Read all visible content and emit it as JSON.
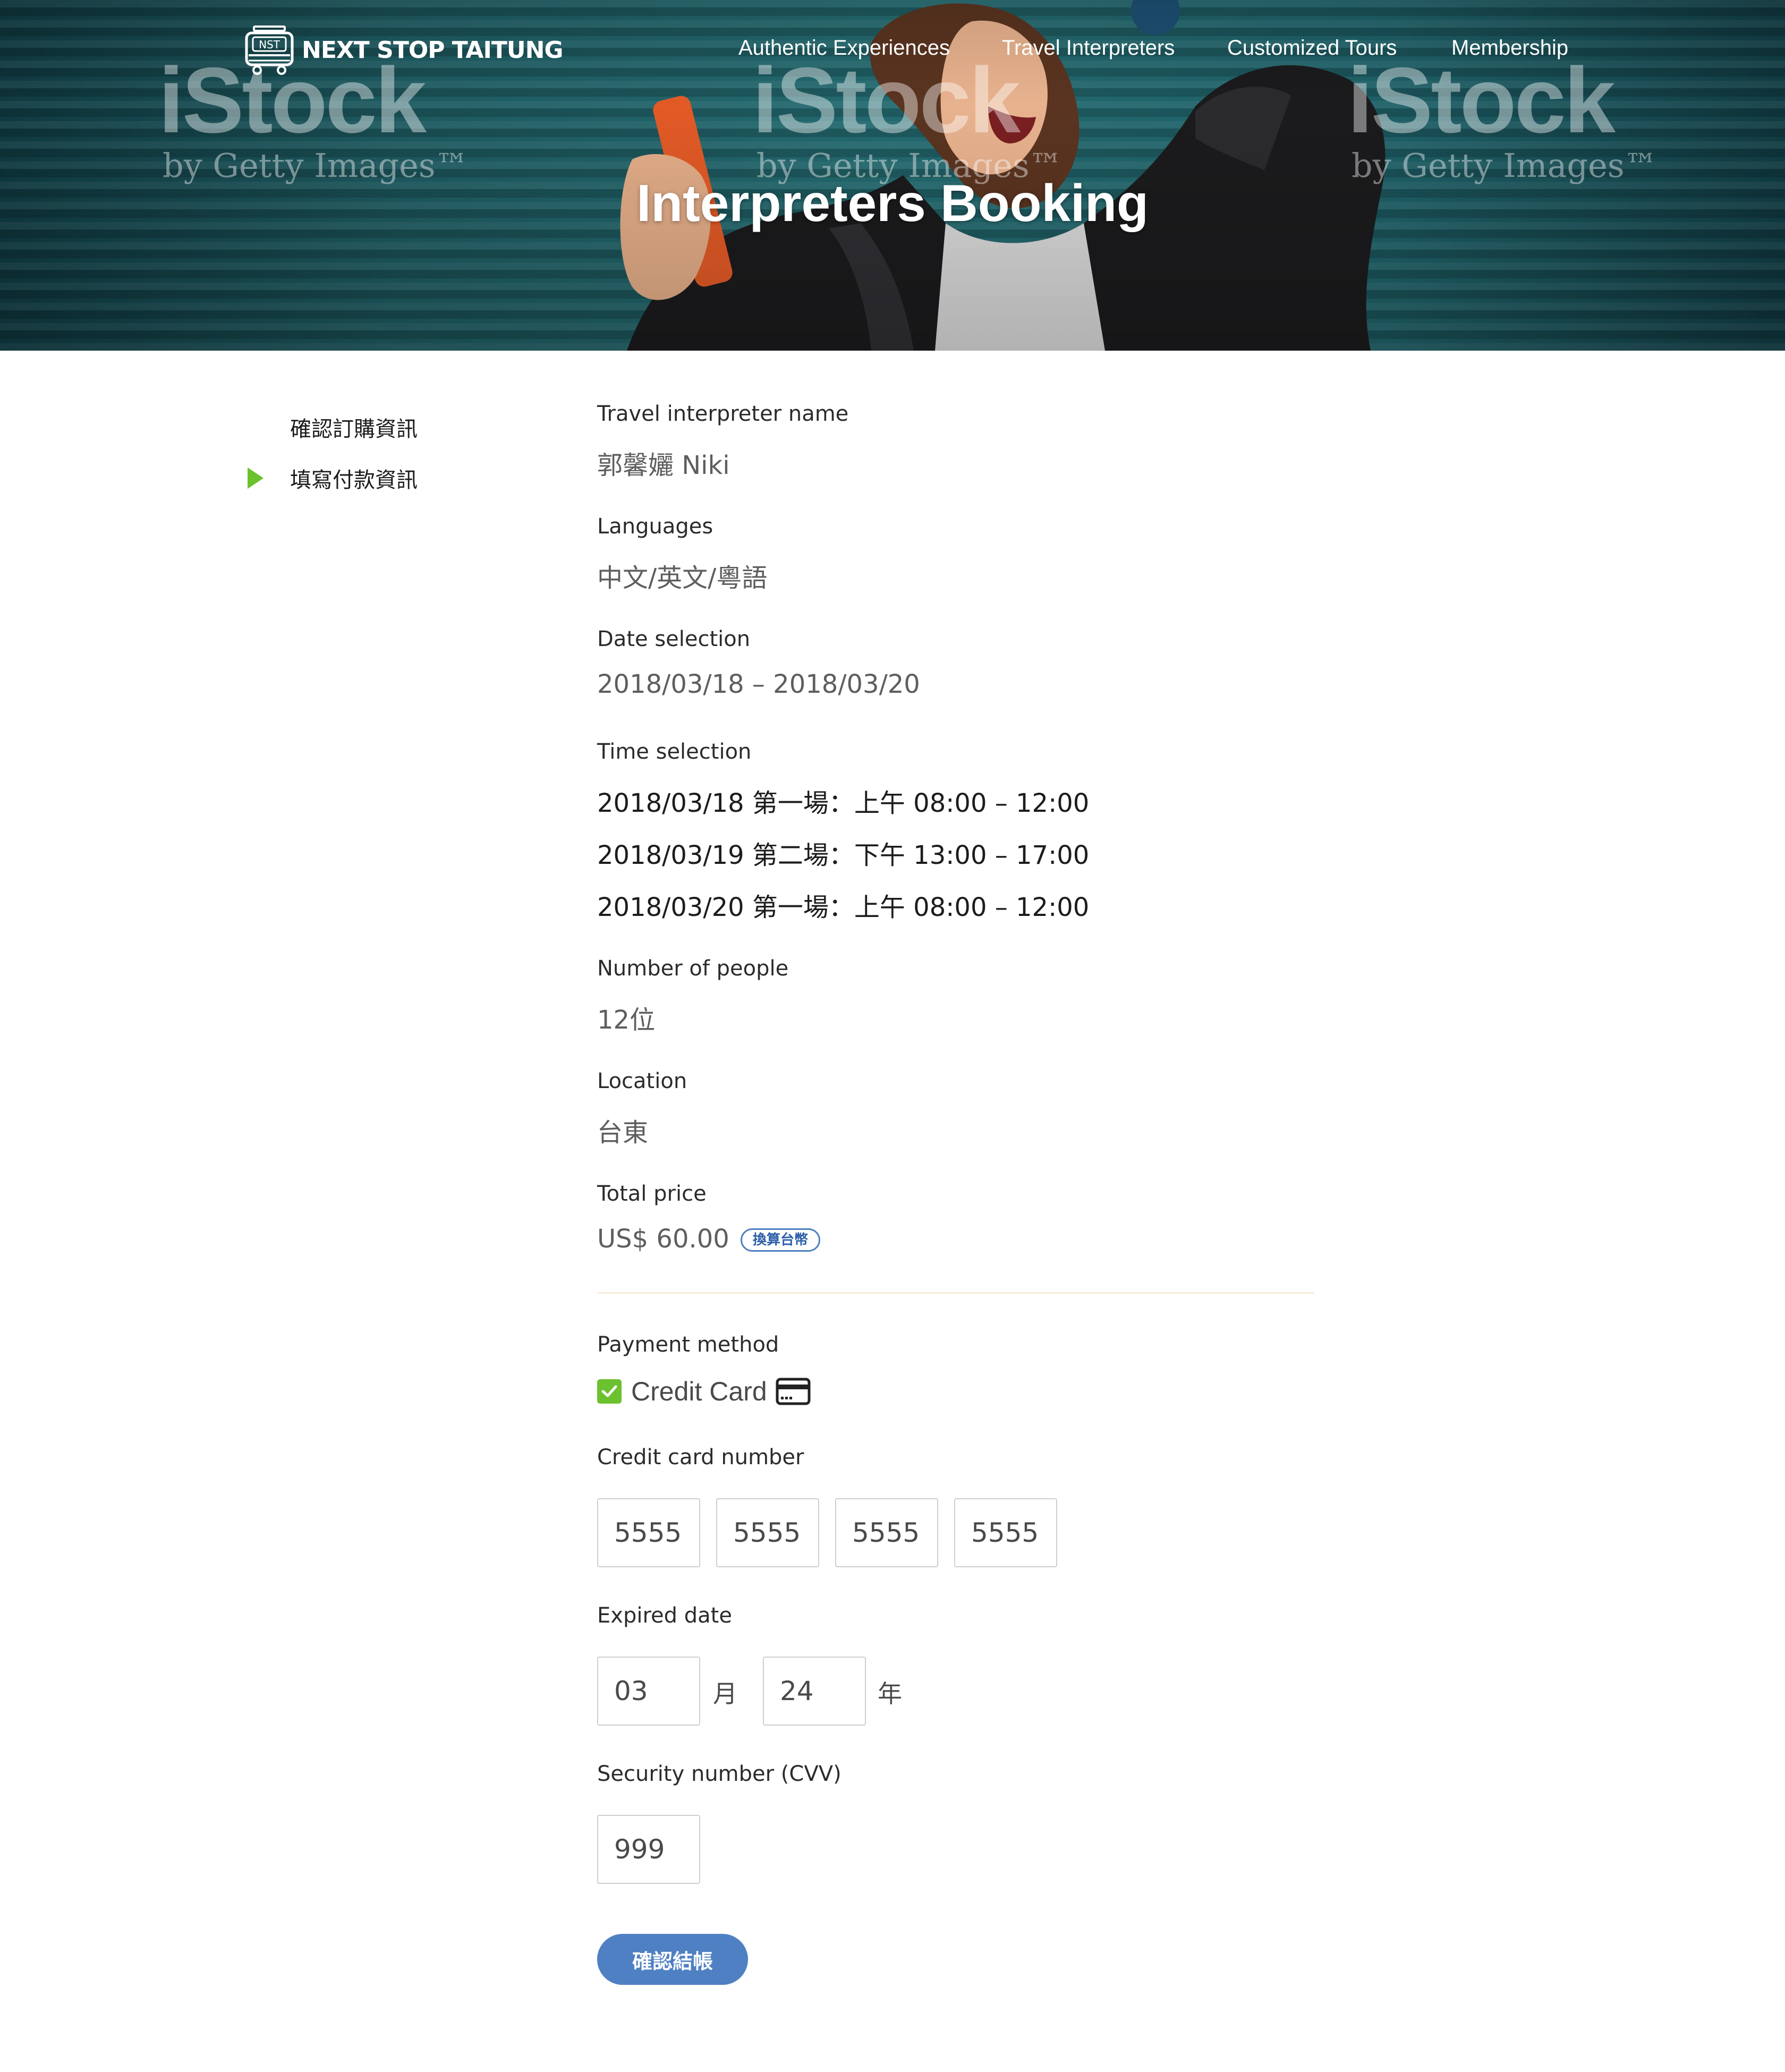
{
  "header": {
    "logo_badge": "NST",
    "logo_text": "NEXT STOP TAITUNG",
    "nav": [
      {
        "label": "Authentic Experiences"
      },
      {
        "label": "Travel Interpreters"
      },
      {
        "label": "Customized Tours"
      },
      {
        "label": "Membership"
      }
    ],
    "watermark_main": "iStock",
    "watermark_sub": "by Getty Images™",
    "title": "Interpreters Booking"
  },
  "sidebar": {
    "items": [
      {
        "label": "確認訂購資訊",
        "active": false
      },
      {
        "label": "填寫付款資訊",
        "active": true
      }
    ],
    "active_marker_color": "#6cc12e"
  },
  "booking": {
    "interpreter_label": "Travel interpreter name",
    "interpreter_value": "郭馨孋 Niki",
    "languages_label": "Languages",
    "languages_value": "中文/英文/粵語",
    "date_label": "Date selection",
    "date_value": "2018/03/18 – 2018/03/20",
    "time_label": "Time selection",
    "time_slots": [
      "2018/03/18 第一場：上午 08:00 – 12:00",
      "2018/03/19 第二場：下午 13:00 – 17:00",
      "2018/03/20 第一場：上午 08:00 – 12:00"
    ],
    "people_label": "Number of people",
    "people_value": "12位",
    "location_label": "Location",
    "location_value": "台東",
    "price_label": "Total price",
    "price_value": "US$ 60.00",
    "convert_label": "換算台幣"
  },
  "payment": {
    "method_label": "Payment method",
    "method_option": "Credit Card",
    "method_checked": true,
    "card_label": "Credit card number",
    "card_parts": [
      "5555",
      "5555",
      "5555",
      "5555"
    ],
    "expiry_label": "Expired date",
    "expiry_month": "03",
    "expiry_month_unit": "月",
    "expiry_year": "24",
    "expiry_year_unit": "年",
    "cvv_label": "Security number (CVV)",
    "cvv_value": "999",
    "submit_label": "確認結帳"
  },
  "colors": {
    "accent_green": "#6cc12e",
    "button_blue": "#4f80c3",
    "divider": "#f6ecd8"
  }
}
